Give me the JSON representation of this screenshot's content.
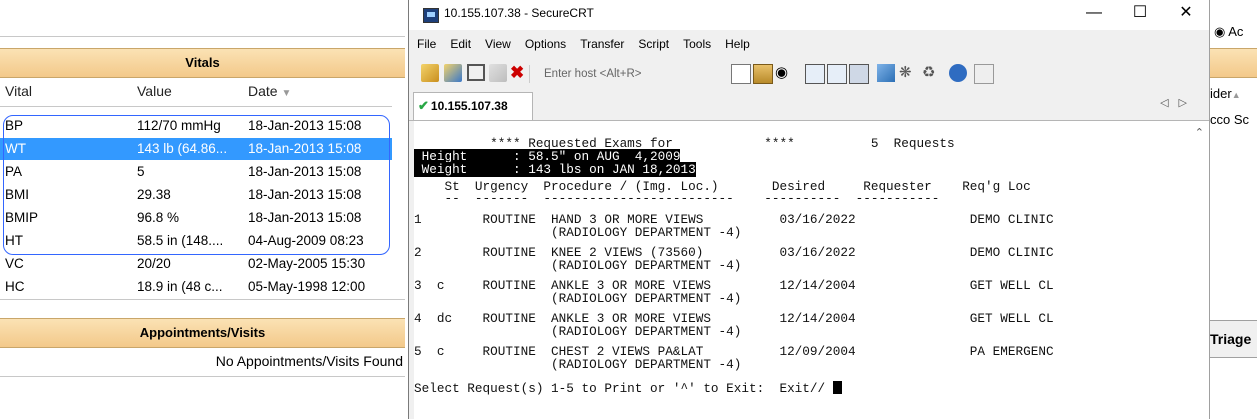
{
  "left_panel": {
    "vitals_header": "Vitals",
    "columns": [
      "Vital",
      "Value",
      "Date"
    ],
    "rows": [
      {
        "vital": "BP",
        "value": "112/70 mmHg",
        "date": "18-Jan-2013 15:08",
        "selected": false
      },
      {
        "vital": "WT",
        "value": "143 lb (64.86...",
        "date": "18-Jan-2013 15:08",
        "selected": true
      },
      {
        "vital": "PA",
        "value": "5",
        "date": "18-Jan-2013 15:08",
        "selected": false
      },
      {
        "vital": "BMI",
        "value": "29.38",
        "date": "18-Jan-2013 15:08",
        "selected": false
      },
      {
        "vital": "BMIP",
        "value": "96.8 %",
        "date": "18-Jan-2013 15:08",
        "selected": false
      },
      {
        "vital": "HT",
        "value": "58.5 in (148....",
        "date": "04-Aug-2009 08:23",
        "selected": false
      },
      {
        "vital": "VC",
        "value": "20/20",
        "date": "02-May-2005 15:30",
        "selected": false
      },
      {
        "vital": "HC",
        "value": "18.9 in (48 c...",
        "date": "05-May-1998 12:00",
        "selected": false
      }
    ],
    "appointments_header": "Appointments/Visits",
    "appointments_empty": "No Appointments/Visits Found"
  },
  "crt": {
    "title": "10.155.107.38 - SecureCRT",
    "menu": [
      "File",
      "Edit",
      "View",
      "Options",
      "Transfer",
      "Script",
      "Tools",
      "Help"
    ],
    "host_placeholder": "Enter host <Alt+R>",
    "tab_label": "10.155.107.38",
    "terminal": {
      "title_line": "          **** Requested Exams for            ****          5  Requests",
      "height_line": " Height      : 58.5\" on AUG  4,2009",
      "weight_line": " Weight      : 143 lbs on JAN 18,2013",
      "header_line": "    St  Urgency  Procedure / (Img. Loc.)       Desired     Requester    Req'g Loc",
      "dash_line": "    --  -------  -------------------------    ----------  -----------",
      "rows": [
        {
          "l1": "1        ROUTINE  HAND 3 OR MORE VIEWS          03/16/2022               DEMO CLINIC",
          "l2": "                  (RADIOLOGY DEPARTMENT -4)"
        },
        {
          "l1": "2        ROUTINE  KNEE 2 VIEWS (73560)          03/16/2022               DEMO CLINIC",
          "l2": "                  (RADIOLOGY DEPARTMENT -4)"
        },
        {
          "l1": "3  c     ROUTINE  ANKLE 3 OR MORE VIEWS         12/14/2004               GET WELL CL",
          "l2": "                  (RADIOLOGY DEPARTMENT -4)"
        },
        {
          "l1": "4  dc    ROUTINE  ANKLE 3 OR MORE VIEWS         12/14/2004               GET WELL CL",
          "l2": "                  (RADIOLOGY DEPARTMENT -4)"
        },
        {
          "l1": "5  c     ROUTINE  CHEST 2 VIEWS PA&LAT          12/09/2004               PA EMERGENC",
          "l2": "                  (RADIOLOGY DEPARTMENT -4)"
        }
      ],
      "prompt": "Select Request(s) 1-5 to Print or '^' to Exit:  Exit// "
    }
  },
  "right_strip": {
    "radio_label": "Ac",
    "col_label": "ider",
    "cell_text": "cco Sc",
    "triage_label": "Triage"
  },
  "colors": {
    "selection": "#3399ff",
    "header_gradient_top": "#fbe2b4",
    "header_gradient_bottom": "#f3c98a",
    "tab_check": "#28a745"
  }
}
